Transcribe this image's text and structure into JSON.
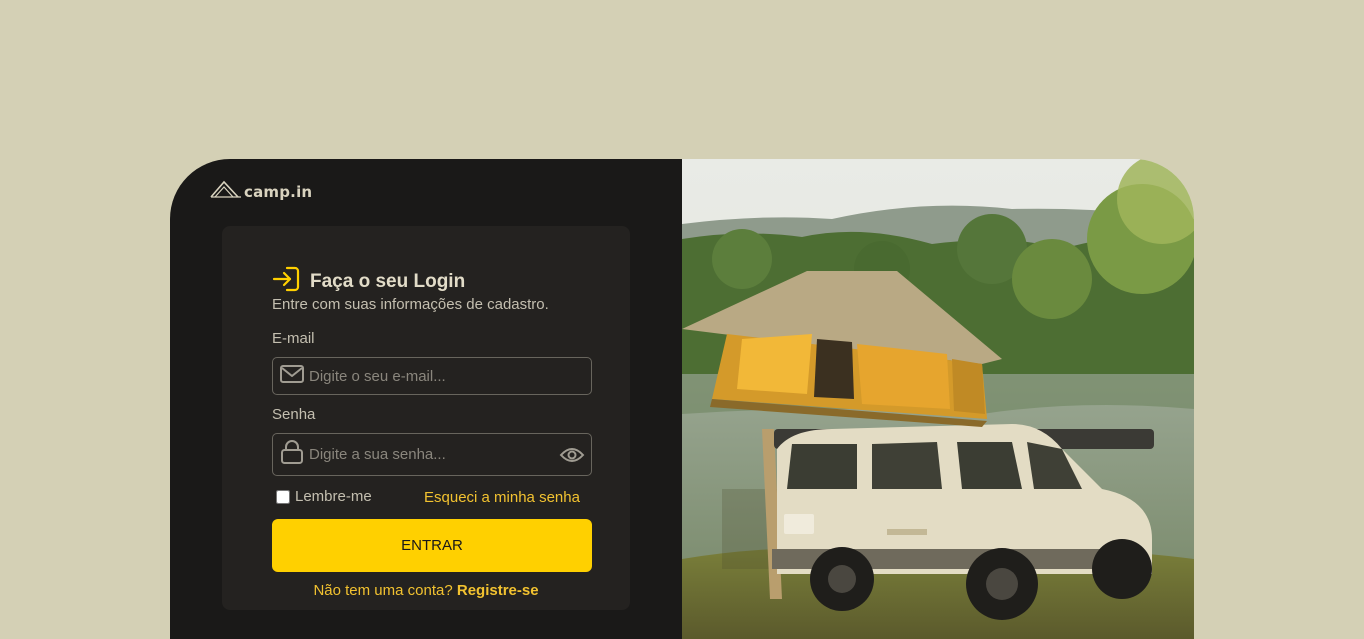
{
  "brand": {
    "name": "camp.in",
    "logo_icon": "tent-logo-icon"
  },
  "login": {
    "title": "Faça o seu Login",
    "subtitle": "Entre com suas informações de cadastro.",
    "email_label": "E-mail",
    "email_placeholder": "Digite o seu e-mail...",
    "password_label": "Senha",
    "password_placeholder": "Digite a sua senha...",
    "remember_label": "Lembre-me",
    "remember_checked": false,
    "forgot_label": "Esqueci a minha senha",
    "submit_label": "ENTRAR",
    "signup_prompt": "Não tem uma conta?",
    "signup_link": "Registre-se"
  },
  "icons": {
    "title": "login-arrow-icon",
    "email": "mail-icon",
    "password": "lock-icon",
    "toggle": "eye-icon"
  },
  "colors": {
    "page_bg": "#d4d0b5",
    "card_bg": "#1a1918",
    "panel_bg": "#242220",
    "accent": "#ffd000",
    "link": "#f2c230"
  },
  "hero_image": {
    "subject": "off-road vehicle with rooftop tent by a lake"
  }
}
